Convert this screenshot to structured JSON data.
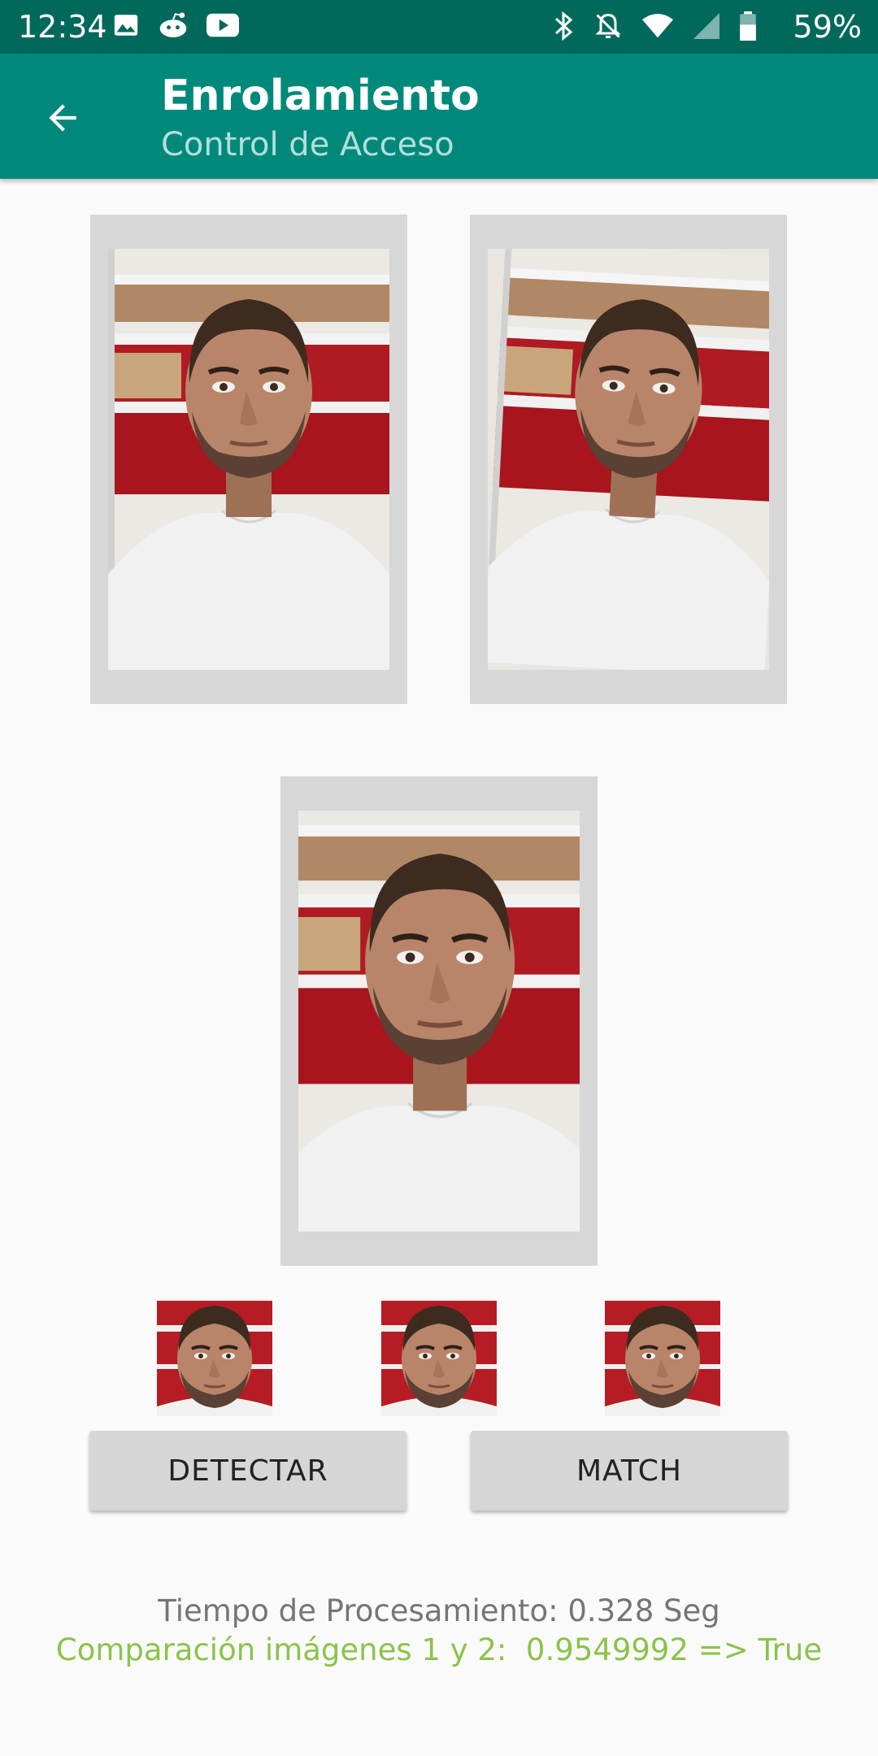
{
  "status_bar": {
    "time": "12:34",
    "battery": "59%",
    "left_icons": [
      "gallery-icon",
      "reddit-icon",
      "youtube-icon"
    ],
    "right_icons": [
      "bluetooth-icon",
      "notifications-off-icon",
      "wifi-icon",
      "signal-icon",
      "battery-icon"
    ]
  },
  "app_bar": {
    "title": "Enrolamiento",
    "subtitle": "Control de Acceso",
    "back_icon": "arrow-back-icon"
  },
  "photos": {
    "photo1": "face-photo-1",
    "photo2": "face-photo-2",
    "photo3": "face-photo-3"
  },
  "thumbnails": [
    "face-crop-1",
    "face-crop-2",
    "face-crop-3"
  ],
  "buttons": {
    "detect": "DETECTAR",
    "match": "MATCH"
  },
  "results": {
    "processing_time": "Tiempo de Procesamiento: 0.328 Seg",
    "comparison": "Comparación imágenes 1 y 2:  0.9549992 => True"
  },
  "colors": {
    "status_bar": "#00695c",
    "app_bar": "#00897b",
    "result_green": "#8bc34a",
    "card_gray": "#d7d7d7"
  }
}
